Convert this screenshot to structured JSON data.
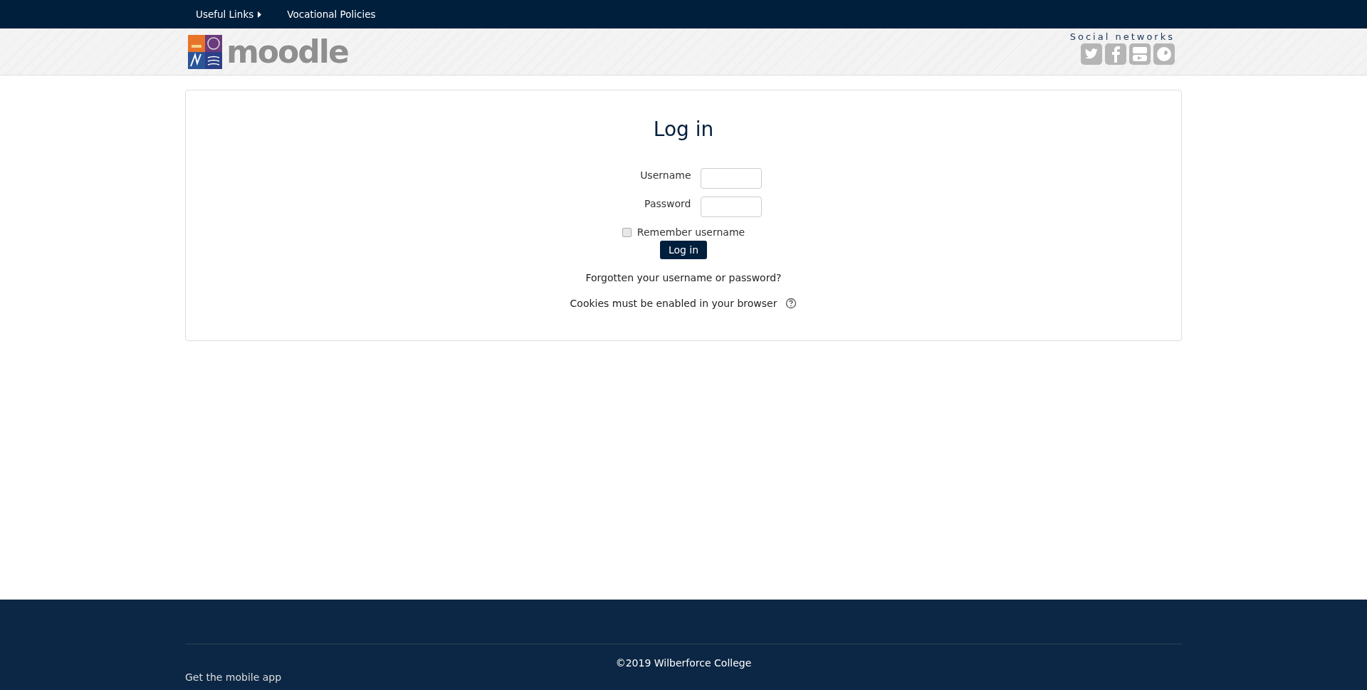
{
  "top_nav": [
    {
      "label": "Useful Links",
      "has_submenu": true
    },
    {
      "label": "Vocational Policies",
      "has_submenu": false
    }
  ],
  "header": {
    "logo_text": "moodle",
    "social_title": "Social networks",
    "social_links": [
      {
        "kind": "bird"
      },
      {
        "kind": "facebook"
      },
      {
        "kind": "video"
      },
      {
        "kind": "globe"
      }
    ]
  },
  "login": {
    "title": "Log in",
    "fields": [
      {
        "label": "Username"
      },
      {
        "label": "Password"
      }
    ],
    "remember": {
      "label": "Remember username",
      "checked": false
    },
    "submit": "Log in",
    "forgot_link": "Forgotten your username or password?",
    "cookies_note": "Cookies must be enabled in your browser"
  },
  "footer": {
    "copyright": "©2019 Wilberforce College",
    "mobile_app": "Get the mobile app"
  }
}
